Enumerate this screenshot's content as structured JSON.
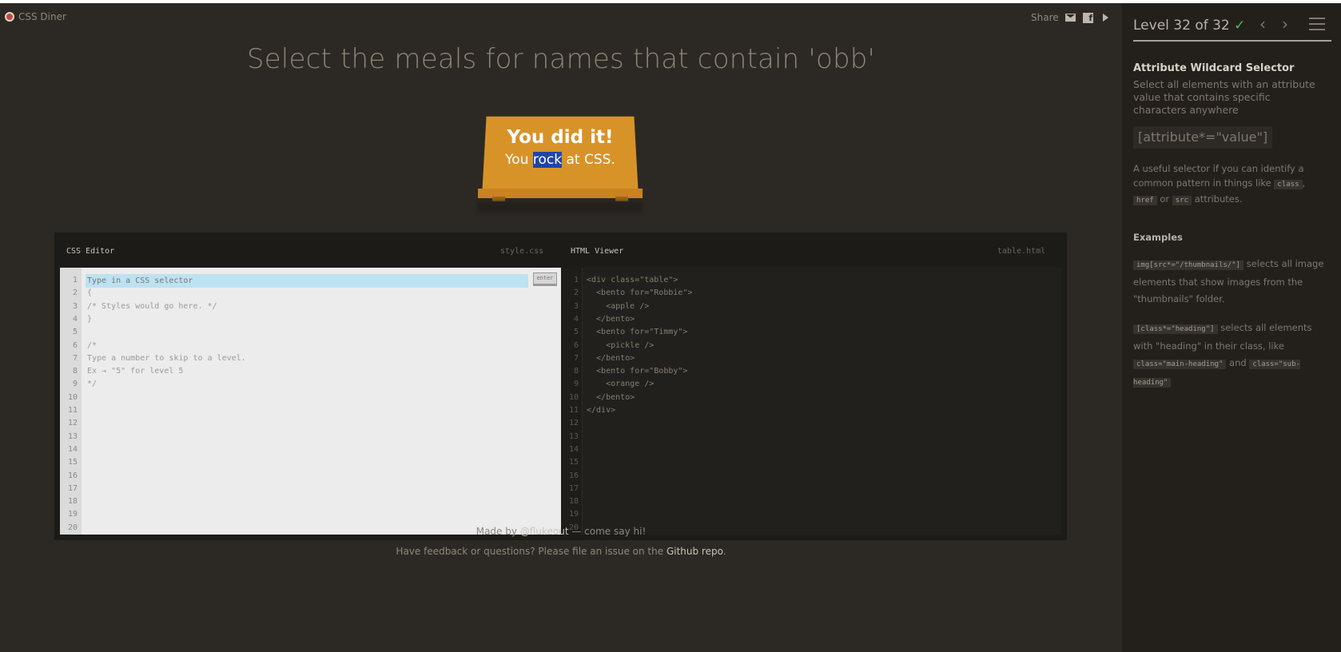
{
  "app": {
    "name": "CSS Diner"
  },
  "share": {
    "label": "Share"
  },
  "level": {
    "instruction": "Select the meals for names that contain 'obb'",
    "indicator": "Level 32 of 32",
    "progress": 1.0
  },
  "table": {
    "line1": "You did it!",
    "line2_before": "You",
    "line2_selected": "rock",
    "line2_after": "at CSS."
  },
  "css_editor": {
    "title": "CSS Editor",
    "filename": "style.css",
    "input_placeholder": "Type in a CSS selector",
    "enter_label": "enter",
    "lines": [
      "{",
      "/* Styles would go here. */",
      "}",
      "",
      "/*",
      "Type a number to skip to a level.",
      "Ex → \"5\" for level 5",
      "*/"
    ]
  },
  "html_viewer": {
    "title": "HTML Viewer",
    "filename": "table.html",
    "lines": [
      "<div class=\"table\">",
      "  <bento for=\"Robbie\">",
      "    <apple />",
      "  </bento>",
      "  <bento for=\"Timmy\">",
      "    <pickle />",
      "  </bento>",
      "  <bento for=\"Bobby\">",
      "    <orange />",
      "  </bento>",
      "</div>"
    ]
  },
  "line_numbers": [
    "1",
    "2",
    "3",
    "4",
    "5",
    "6",
    "7",
    "8",
    "9",
    "10",
    "11",
    "12",
    "13",
    "14",
    "15",
    "16",
    "17",
    "18",
    "19",
    "20"
  ],
  "footer": {
    "made_by_prefix": "Made by",
    "made_by_handle": "@flukeout",
    "made_by_suffix": "— come say hi!",
    "feedback_prefix": "Have feedback or questions? Please file an issue on the",
    "repo_link": "Github repo",
    "feedback_suffix": "."
  },
  "sidebar": {
    "selector_title": "Attribute Wildcard Selector",
    "description": "Select all elements with an attribute value that contains specific characters anywhere",
    "syntax": "[attribute*=\"value\"]",
    "hint_before": "A useful selector if you can identify a common pattern in things like",
    "hint_tag1": "class",
    "hint_sep": ",",
    "hint_tag2": "href",
    "hint_or": "or",
    "hint_tag3": "src",
    "hint_after": "attributes.",
    "examples_heading": "Examples",
    "example1_code": "img[src*=\"/thumbnails/\"]",
    "example1_text": "selects all image elements that show images from the \"thumbnails\" folder.",
    "example2_code": "[class*=\"heading\"]",
    "example2_text_a": "selects all elements with \"heading\" in their class, like",
    "example2_code2": "class=\"main-heading\"",
    "example2_and": "and",
    "example2_code3": "class=\"sub-heading\""
  },
  "icons": {
    "brand": "logo-icon",
    "mail": "mail-icon",
    "facebook": "facebook-icon",
    "twitter": "twitter-icon",
    "prev": "chevron-left-icon",
    "next": "chevron-right-icon",
    "menu": "menu-icon"
  },
  "colors": {
    "background": "#2c2924",
    "table": "#d89328",
    "success": "#4cbb4a",
    "input_highlight": "#bde2f2"
  }
}
